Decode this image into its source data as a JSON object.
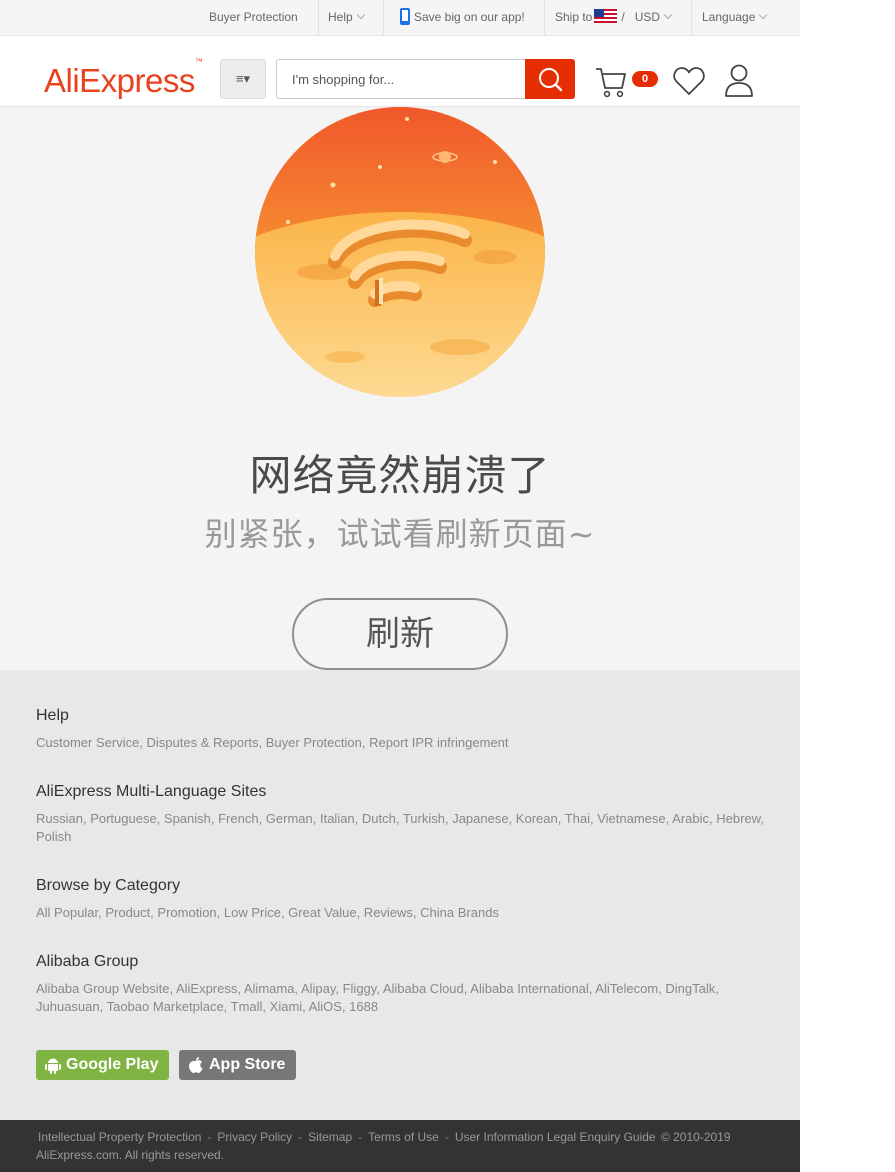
{
  "topbar": {
    "buyer_protection": "Buyer Protection",
    "help": "Help",
    "app_promo": "Save big on our app!",
    "ship_to": "Ship to",
    "slash": "/",
    "currency": "USD",
    "language": "Language"
  },
  "header": {
    "logo": "AliExpress",
    "logo_tm": "™",
    "menu_icon": "≡▾",
    "search_placeholder": "I'm shopping for...",
    "cart_count": "0"
  },
  "error": {
    "title": "网络竟然崩溃了",
    "subtitle": "别紧张，试试看刷新页面~",
    "refresh_label": "刷新"
  },
  "footer": {
    "sections": [
      {
        "title": "Help",
        "links": "Customer Service, Disputes & Reports, Buyer Protection, Report IPR infringement"
      },
      {
        "title": "AliExpress Multi-Language Sites",
        "links": "Russian, Portuguese, Spanish, French, German, Italian, Dutch, Turkish, Japanese, Korean, Thai, Vietnamese, Arabic, Hebrew, Polish"
      },
      {
        "title": "Browse by Category",
        "links": "All Popular, Product, Promotion, Low Price, Great Value, Reviews, China Brands"
      },
      {
        "title": "Alibaba Group",
        "links": "Alibaba Group Website, AliExpress, Alimama, Alipay, Fliggy, Alibaba Cloud, Alibaba International, AliTelecom, DingTalk, Juhuasuan, Taobao Marketplace, Tmall, Xiami, AliOS, 1688"
      }
    ],
    "google_play": "Google Play",
    "app_store": "App Store"
  },
  "bottom_bar": {
    "links": [
      "Intellectual Property Protection",
      "Privacy Policy",
      "Sitemap",
      "Terms of Use",
      "User Information Legal Enquiry Guide"
    ],
    "copyright_1": "© 2010-2019",
    "copyright_2": "AliExpress.com. All rights reserved."
  },
  "colors": {
    "brand": "#e62e04",
    "logo": "#e8421f",
    "google_play": "#7fb342",
    "app_store": "#777777"
  },
  "icons": [
    "phone-icon",
    "us-flag-icon",
    "menu-icon",
    "search-icon",
    "cart-icon",
    "heart-icon",
    "user-icon",
    "android-icon",
    "apple-icon"
  ]
}
